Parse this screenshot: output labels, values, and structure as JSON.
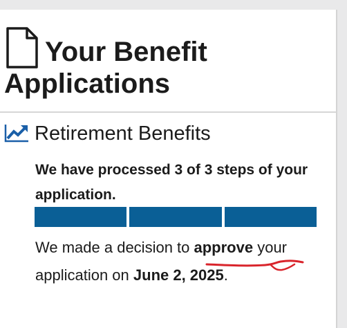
{
  "page": {
    "title_line1": "Your Benefit",
    "title_line2": "Applications"
  },
  "icons": {
    "document": "document-icon",
    "trend": "trending-up-icon"
  },
  "benefit": {
    "name": "Retirement Benefits",
    "steps_text": "We have processed 3 of 3 steps of your application.",
    "steps_completed": 3,
    "steps_total": 3,
    "decision_prefix": "We made a decision to ",
    "decision_word": "approve",
    "decision_middle": " your application on ",
    "decision_date": "June 2, 2025",
    "decision_suffix": "."
  },
  "colors": {
    "progress_complete": "#0a5f96",
    "trend_icon": "#1a5fa8",
    "annotation": "#d9242b"
  }
}
